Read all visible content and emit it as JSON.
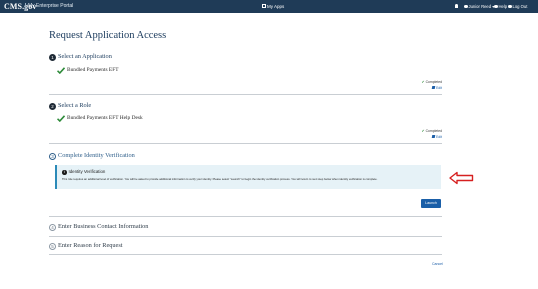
{
  "topbar": {
    "brand": "CMS.gov",
    "portal": "My Enterprise Portal",
    "my_apps": "My Apps",
    "user": "Junior Reed",
    "help": "Help",
    "logout": "Log Out"
  },
  "page": {
    "title": "Request Application Access",
    "cancel": "Cancel"
  },
  "steps": [
    {
      "number": "1",
      "title": "Select an Application",
      "selected": "Bundled Payments EFT",
      "status": "Completed",
      "edit": "Edit"
    },
    {
      "number": "2",
      "title": "Select a Role",
      "selected": "Bundled Payments EFT Help Desk",
      "status": "Completed",
      "edit": "Edit"
    },
    {
      "number": "3",
      "title": "Complete Identity Verification"
    },
    {
      "number": "4",
      "title": "Enter Business Contact Information"
    },
    {
      "number": "5",
      "title": "Enter Reason for Request"
    }
  ],
  "identity_box": {
    "heading": "Identity Verification",
    "description": "This role requires an additional level of verification. You will be asked to provide additional information to verify your identity. Please select \"Launch\" to begin the identity verification process. You will return to next step below when identity verification is complete.",
    "launch": "Launch"
  },
  "colors": {
    "topbar": "#1f3b57",
    "primary": "#1a5fa8",
    "success": "#2e8b3a",
    "info_bg": "#e6f2f7",
    "annotation": "#d62020"
  },
  "icons": [
    "apps-icon",
    "bell-icon",
    "user-icon",
    "help-icon",
    "logout-icon",
    "check-icon",
    "edit-icon",
    "info-icon",
    "annotation-arrow-icon"
  ]
}
